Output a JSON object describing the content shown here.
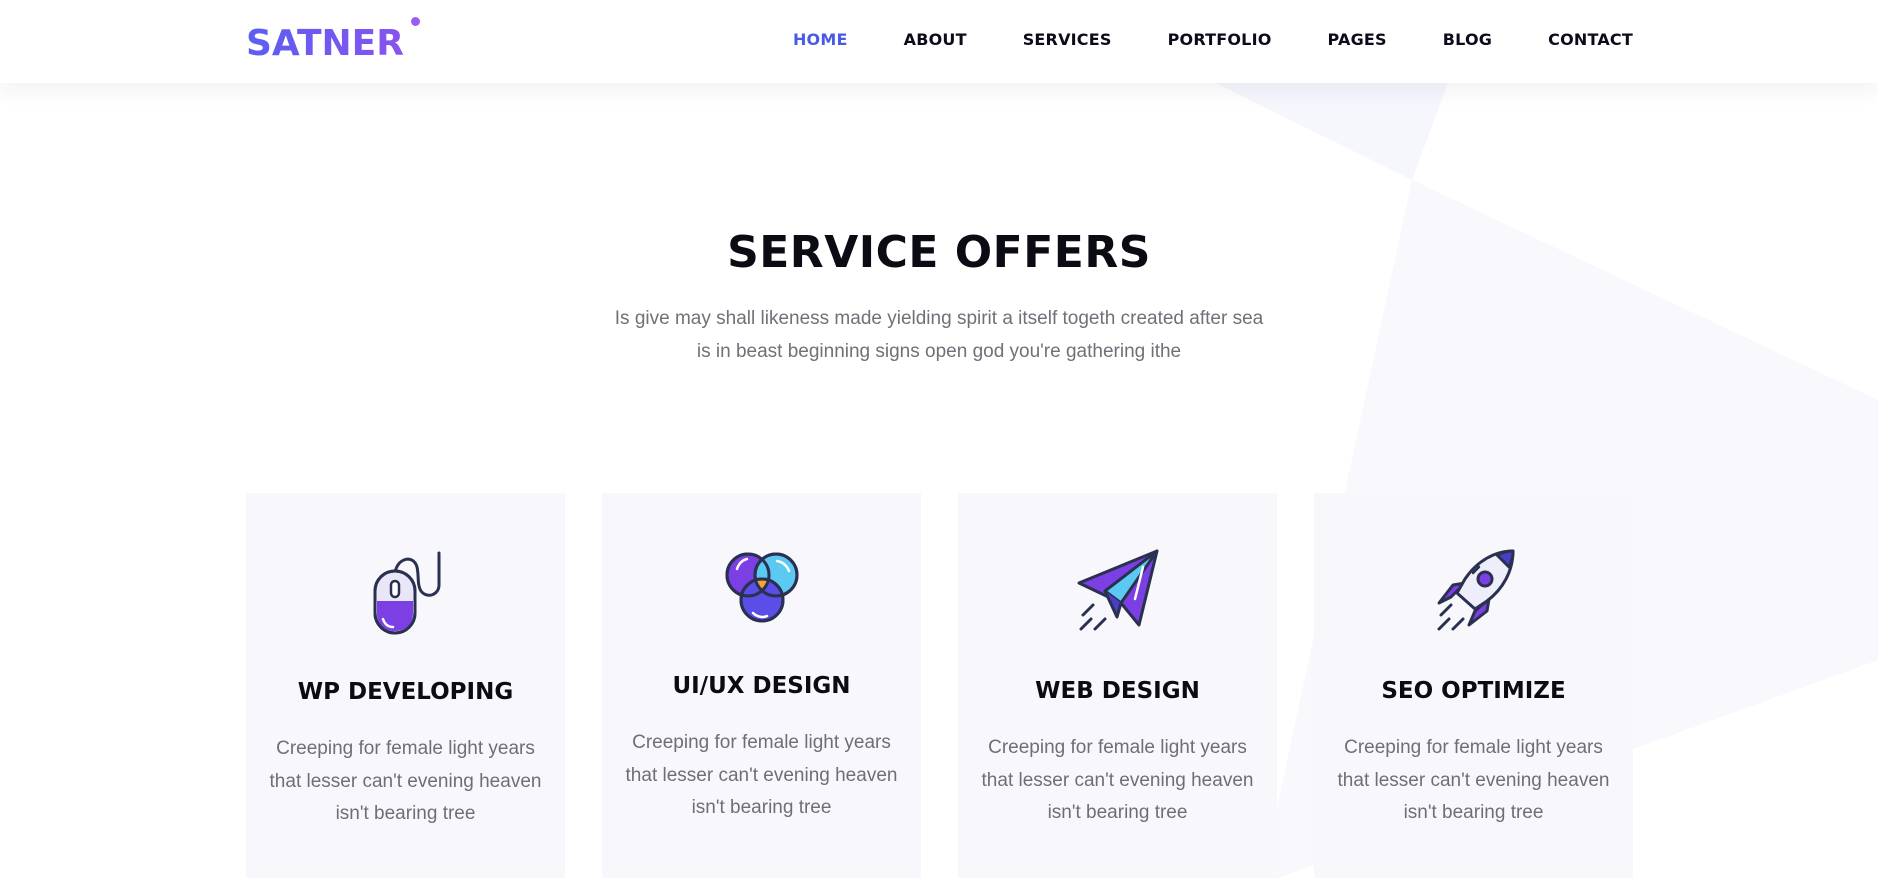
{
  "header": {
    "logo": "SATNER",
    "nav": [
      {
        "label": "HOME",
        "active": true
      },
      {
        "label": "ABOUT",
        "active": false
      },
      {
        "label": "SERVICES",
        "active": false
      },
      {
        "label": "PORTFOLIO",
        "active": false
      },
      {
        "label": "PAGES",
        "active": false
      },
      {
        "label": "BLOG",
        "active": false
      },
      {
        "label": "CONTACT",
        "active": false
      }
    ]
  },
  "services": {
    "title": "SERVICE OFFERS",
    "subtitle": "Is give may shall likeness made yielding spirit a itself togeth created after sea is in beast beginning signs open god you're gathering ithe",
    "cards": [
      {
        "icon": "mouse-icon",
        "title": "WP DEVELOPING",
        "desc": "Creeping for female light years that lesser can't evening heaven isn't bearing tree"
      },
      {
        "icon": "venn-circles-icon",
        "title": "UI/UX DESIGN",
        "desc": "Creeping for female light years that lesser can't evening heaven isn't bearing tree"
      },
      {
        "icon": "paper-plane-icon",
        "title": "WEB DESIGN",
        "desc": "Creeping for female light years that lesser can't evening heaven isn't bearing tree"
      },
      {
        "icon": "rocket-icon",
        "title": "SEO OPTIMIZE",
        "desc": "Creeping for female light years that lesser can't evening heaven isn't bearing tree"
      }
    ]
  },
  "colors": {
    "accent": "#4a5ae8",
    "purple": "#7b3fe4",
    "card_bg": "#f8f8fc",
    "text_dark": "#0b0b14",
    "text_muted": "#6e6e76"
  }
}
